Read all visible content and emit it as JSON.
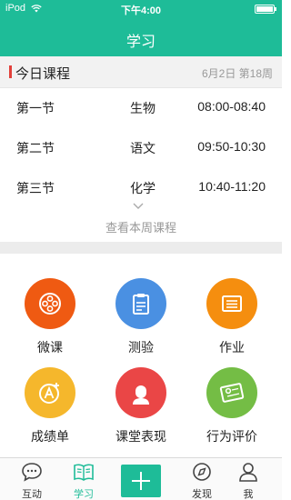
{
  "status": {
    "carrier": "iPod",
    "time": "下午4:00"
  },
  "header": {
    "title": "学习"
  },
  "section": {
    "title": "今日课程",
    "date": "6月2日 第18周"
  },
  "courses": [
    {
      "period": "第一节",
      "subject": "生物",
      "time": "08:00-08:40"
    },
    {
      "period": "第二节",
      "subject": "语文",
      "time": "09:50-10:30"
    },
    {
      "period": "第三节",
      "subject": "化学",
      "time": "10:40-11:20"
    }
  ],
  "view_week": "查看本周课程",
  "grid": [
    {
      "label": "微课",
      "icon": "film-reel-icon",
      "color": "#ef5a12"
    },
    {
      "label": "测验",
      "icon": "clipboard-icon",
      "color": "#4a90e2"
    },
    {
      "label": "作业",
      "icon": "list-document-icon",
      "color": "#f58e0f"
    },
    {
      "label": "成绩单",
      "icon": "grade-a-plus-icon",
      "color": "#f5b72c"
    },
    {
      "label": "课堂表现",
      "icon": "student-avatar-icon",
      "color": "#ea4646"
    },
    {
      "label": "行为评价",
      "icon": "certificate-icon",
      "color": "#74bd45"
    }
  ],
  "nav": [
    {
      "label": "互动",
      "icon": "chat-bubble-icon"
    },
    {
      "label": "学习",
      "icon": "open-book-icon",
      "active": true
    },
    {
      "label": "发现",
      "icon": "compass-icon"
    },
    {
      "label": "我",
      "icon": "person-icon"
    }
  ],
  "colors": {
    "brand": "#1ebc98",
    "accent_bar": "#e2403a"
  }
}
